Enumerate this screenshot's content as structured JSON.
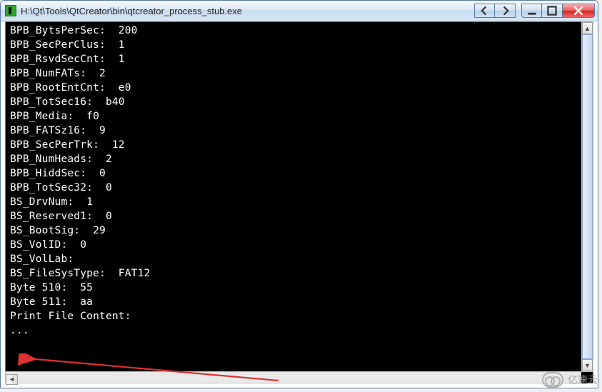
{
  "window": {
    "title": "H:\\Qt\\Tools\\QtCreator\\bin\\qtcreator_process_stub.exe"
  },
  "console": {
    "lines": [
      "BPB_BytsPerSec:  200",
      "BPB_SecPerClus:  1",
      "BPB_RsvdSecCnt:  1",
      "BPB_NumFATs:  2",
      "BPB_RootEntCnt:  e0",
      "BPB_TotSec16:  b40",
      "BPB_Media:  f0",
      "BPB_FATSz16:  9",
      "BPB_SecPerTrk:  12",
      "BPB_NumHeads:  2",
      "BPB_HiddSec:  0",
      "BPB_TotSec32:  0",
      "BS_DrvNum:  1",
      "BS_Reserved1:  0",
      "BS_BootSig:  29",
      "BS_VolID:  0",
      "BS_VolLab:",
      "BS_FileSysType:  FAT12",
      "Byte 510:  55",
      "Byte 511:  aa",
      "",
      "",
      "Print File Content:",
      "..."
    ]
  },
  "watermark": {
    "text": "亿速云"
  }
}
